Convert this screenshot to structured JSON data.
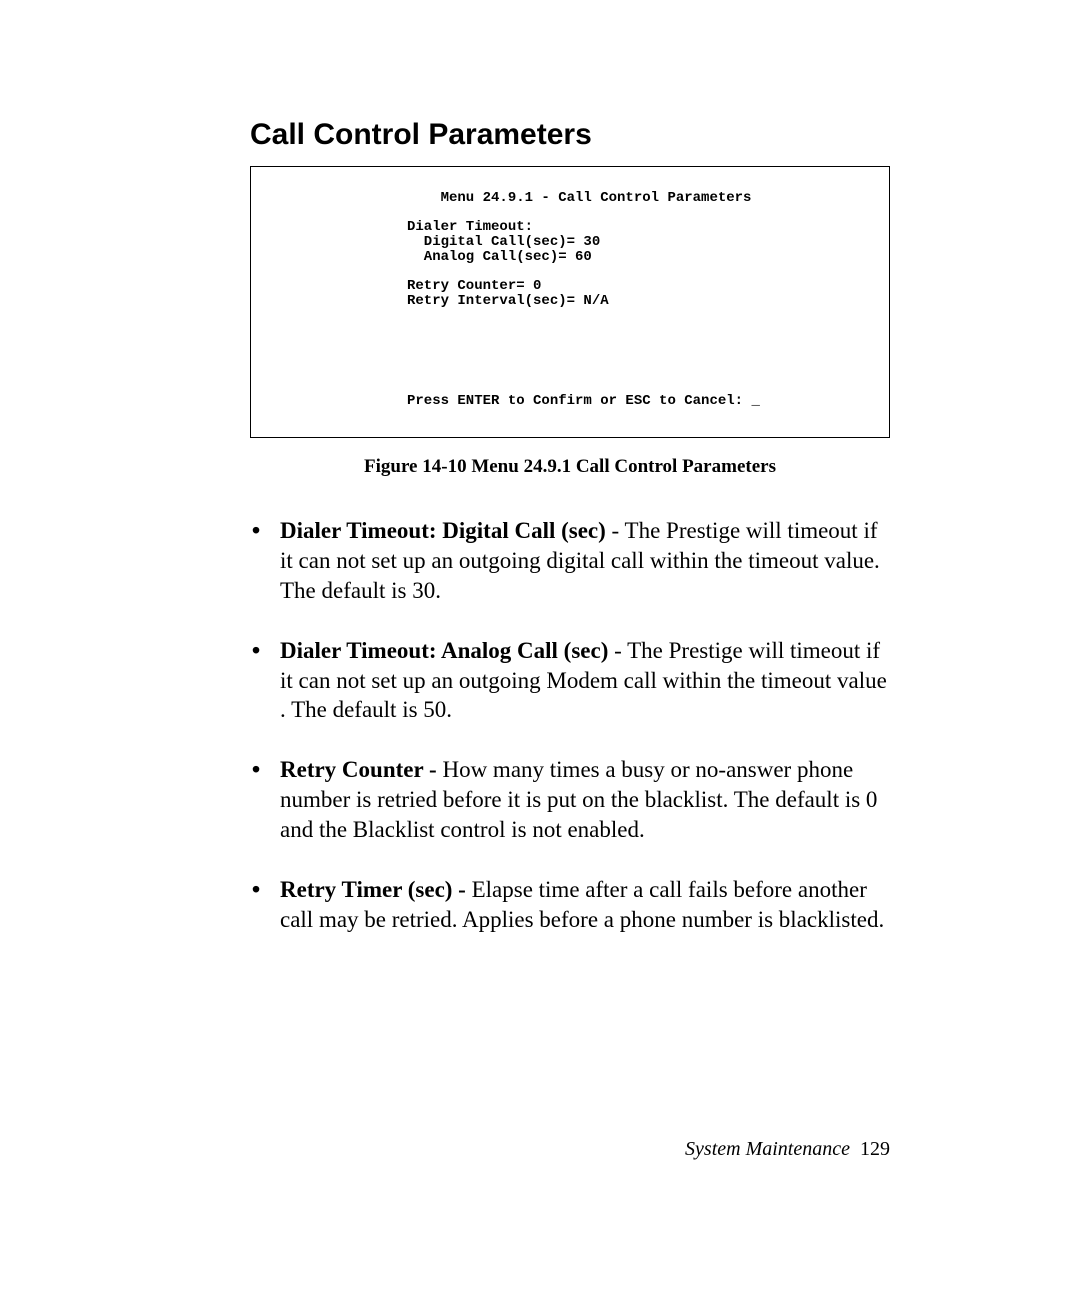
{
  "section_title": "Call Control Parameters",
  "terminal": {
    "title_line": "    Menu 24.9.1 - Call Control Parameters",
    "l1": "Dialer Timeout:",
    "l2": "  Digital Call(sec)= 30",
    "l3": "  Analog Call(sec)= 60",
    "l4": "Retry Counter= 0",
    "l5": "Retry Interval(sec)= N/A",
    "footer": "Press ENTER to Confirm or ESC to Cancel: _"
  },
  "figure_caption": "Figure 14-10 Menu 24.9.1 Call Control Parameters",
  "bullets": [
    {
      "bold": "Dialer Timeout: Digital Call (sec)",
      "rest": " - The Prestige will timeout if it can not set up an outgoing digital call within the timeout value. The default is 30."
    },
    {
      "bold": "Dialer Timeout: Analog Call (sec)",
      "rest": " - The Prestige will timeout if it can not set up an outgoing Modem call within the timeout value . The default is 50."
    },
    {
      "bold": "Retry Counter - ",
      "rest": " How many times a busy or no-answer phone number is retried before it is put on the blacklist. The default is 0 and the Blacklist control is not enabled."
    },
    {
      "bold": "Retry Timer (sec) - ",
      "rest": "Elapse time after a call fails before another call may be retried.  Applies before a phone number is blacklisted."
    }
  ],
  "footer": {
    "label": "System Maintenance",
    "page": "129"
  }
}
